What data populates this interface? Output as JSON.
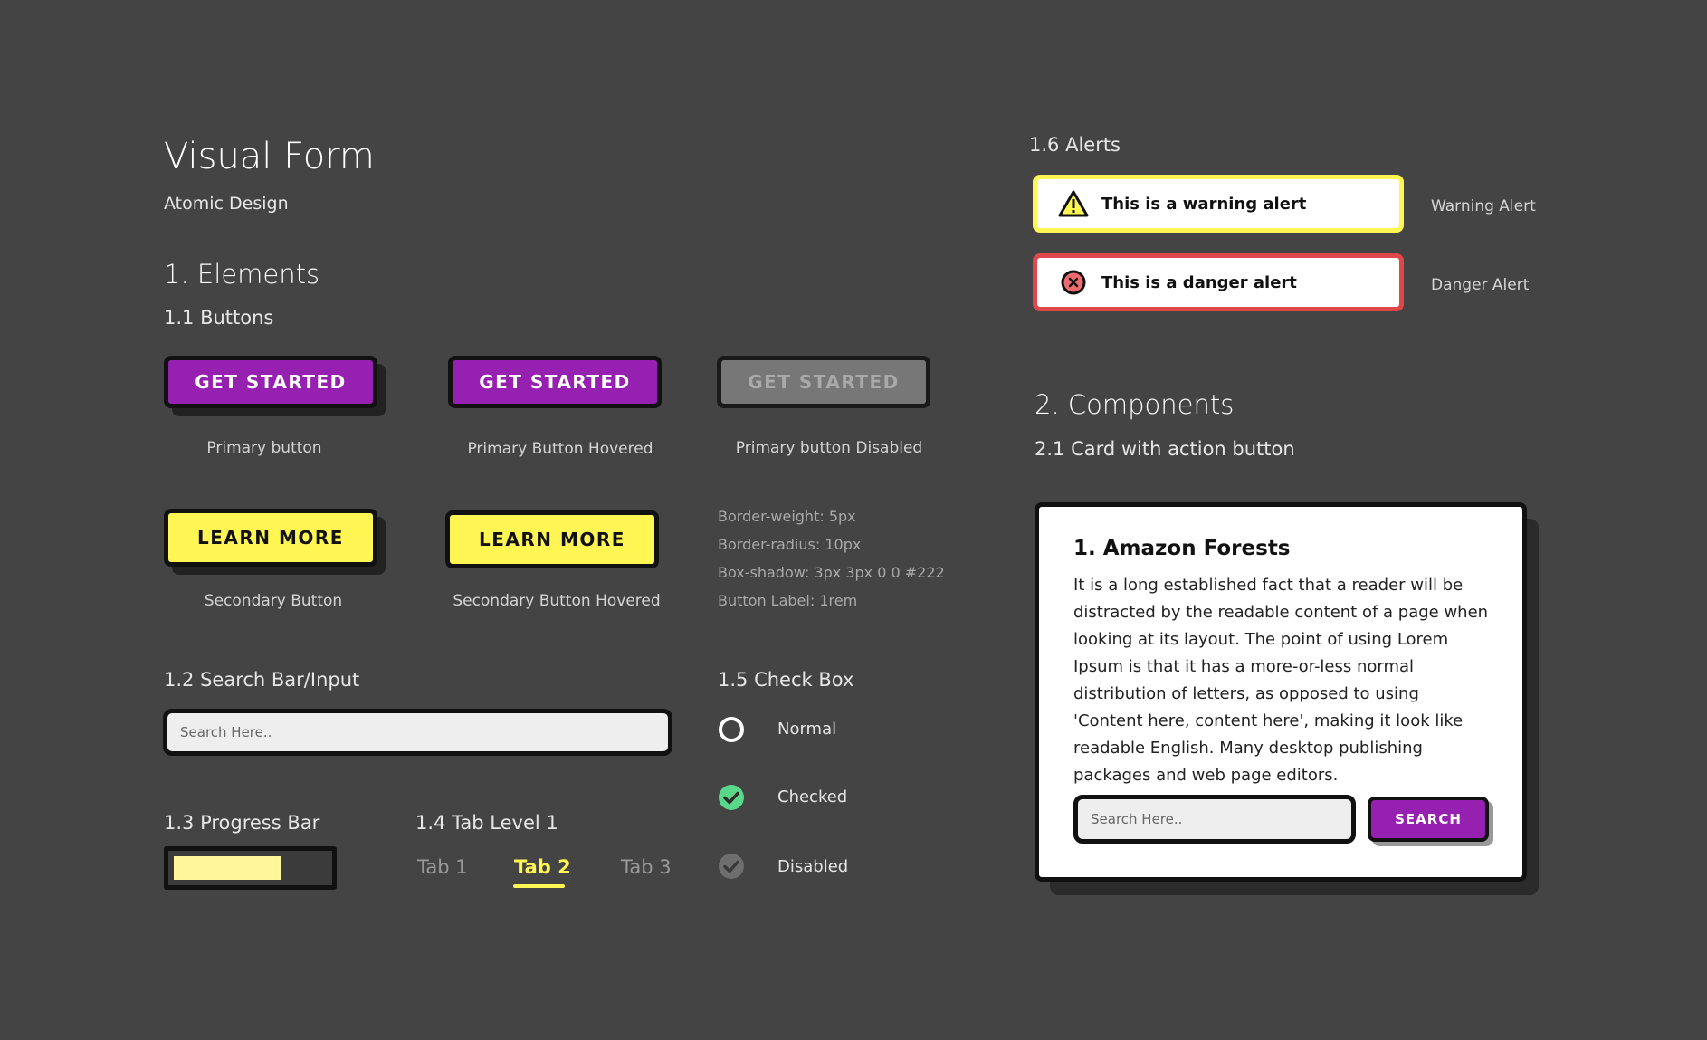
{
  "header": {
    "title": "Visual Form",
    "subtitle": "Atomic Design"
  },
  "elements": {
    "heading": "1. Elements",
    "buttons": {
      "heading": "1.1 Buttons",
      "primary": {
        "label": "GET STARTED",
        "caption": "Primary button"
      },
      "primary_hovered": {
        "label": "GET STARTED",
        "caption": "Primary Button Hovered"
      },
      "primary_disabled": {
        "label": "GET STARTED",
        "caption": "Primary button Disabled"
      },
      "secondary": {
        "label": "LEARN MORE",
        "caption": "Secondary Button"
      },
      "secondary_hovered": {
        "label": "LEARN MORE",
        "caption": "Secondary Button Hovered"
      },
      "specs": [
        "Border-weight: 5px",
        "Border-radius: 10px",
        "Box-shadow: 3px 3px 0 0 #222",
        "Button Label: 1rem"
      ]
    },
    "search": {
      "heading": "1.2 Search Bar/Input",
      "placeholder": "Search Here.."
    },
    "progress": {
      "heading": "1.3 Progress Bar",
      "value": 0.7
    },
    "tabs": {
      "heading": "1.4 Tab Level 1",
      "items": [
        {
          "label": "Tab 1",
          "active": false
        },
        {
          "label": "Tab 2",
          "active": true
        },
        {
          "label": "Tab 3",
          "active": false
        }
      ]
    },
    "checkbox": {
      "heading": "1.5 Check Box",
      "items": [
        {
          "label": "Normal",
          "state": "normal"
        },
        {
          "label": "Checked",
          "state": "checked"
        },
        {
          "label": "Disabled",
          "state": "disabled"
        }
      ]
    },
    "alerts": {
      "heading": "1.6 Alerts",
      "warning": {
        "text": "This is a warning alert",
        "caption": "Warning Alert",
        "icon": "warning-icon"
      },
      "danger": {
        "text": "This is a danger alert",
        "caption": "Danger Alert",
        "icon": "danger-icon"
      }
    }
  },
  "components": {
    "heading": "2. Components",
    "card_heading": "2.1 Card with action button",
    "card": {
      "title": "1. Amazon Forests",
      "body": "It is a long established fact that a reader will be distracted by the readable content of a page when looking at its layout. The point of using Lorem Ipsum is that it has a more-or-less normal distribution of letters, as opposed to using 'Content here, content here', making it look like readable English. Many desktop publishing packages and web page editors.",
      "search_placeholder": "Search Here..",
      "button_label": "SEARCH"
    }
  },
  "colors": {
    "background": "#444444",
    "primary": "#9620b0",
    "secondary": "#fff653",
    "success": "#5ad88a",
    "danger": "#e0464a",
    "disabled": "#777777"
  }
}
